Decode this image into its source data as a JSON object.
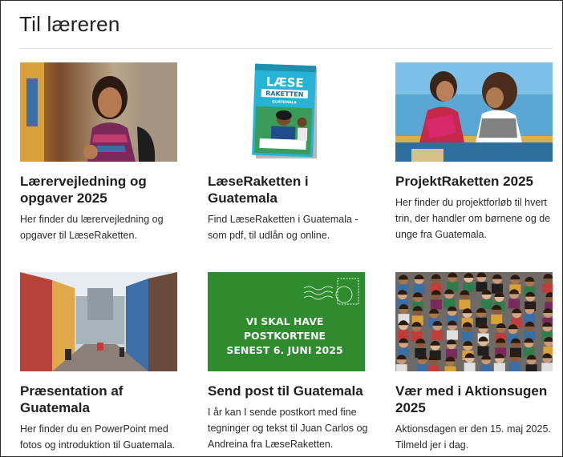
{
  "section_title": "Til læreren",
  "cards": [
    {
      "title": "Lærervejledning og opgaver 2025",
      "desc": "Her finder du lærervejledning og opgaver til LæseRaketten.",
      "image": "photo-girl-with-backpack"
    },
    {
      "title": "LæseRaketten i Guatemala",
      "desc": "Find LæseRaketten i Guatemala - som pdf, til udlån og online.",
      "image": "magazine-cover",
      "image_text": {
        "line1": "LÆSE",
        "line2": "RAKETTEN",
        "sub": "GUATEMALA"
      }
    },
    {
      "title": "ProjektRaketten 2025",
      "desc": "Her finder du projektforløb til hvert trin, der handler om børnene og de unge fra Guatemala.",
      "image": "photo-two-girls-reading"
    },
    {
      "title": "Præsentation af Guatemala",
      "desc": "Her finder du en PowerPoint med fotos og introduktion til Guatemala.",
      "image": "photo-colorful-street"
    },
    {
      "title": "Send post til Guatemala",
      "desc": "I år kan I sende postkort med fine tegninger og tekst til Juan Carlos og Andreina fra LæseRaketten.",
      "image": "green-postcard-banner",
      "image_text": {
        "line1": "VI SKAL HAVE",
        "line2": "POSTKORTENE",
        "line3": "SENEST 6. JUNI 2025"
      },
      "image_color": "#2e8b2e"
    },
    {
      "title": "Vær med i Aktionsugen 2025",
      "desc": "Aktionsdagen er den 15. maj 2025. Tilmeld jer i dag.",
      "image": "photo-crowd-of-children"
    }
  ]
}
